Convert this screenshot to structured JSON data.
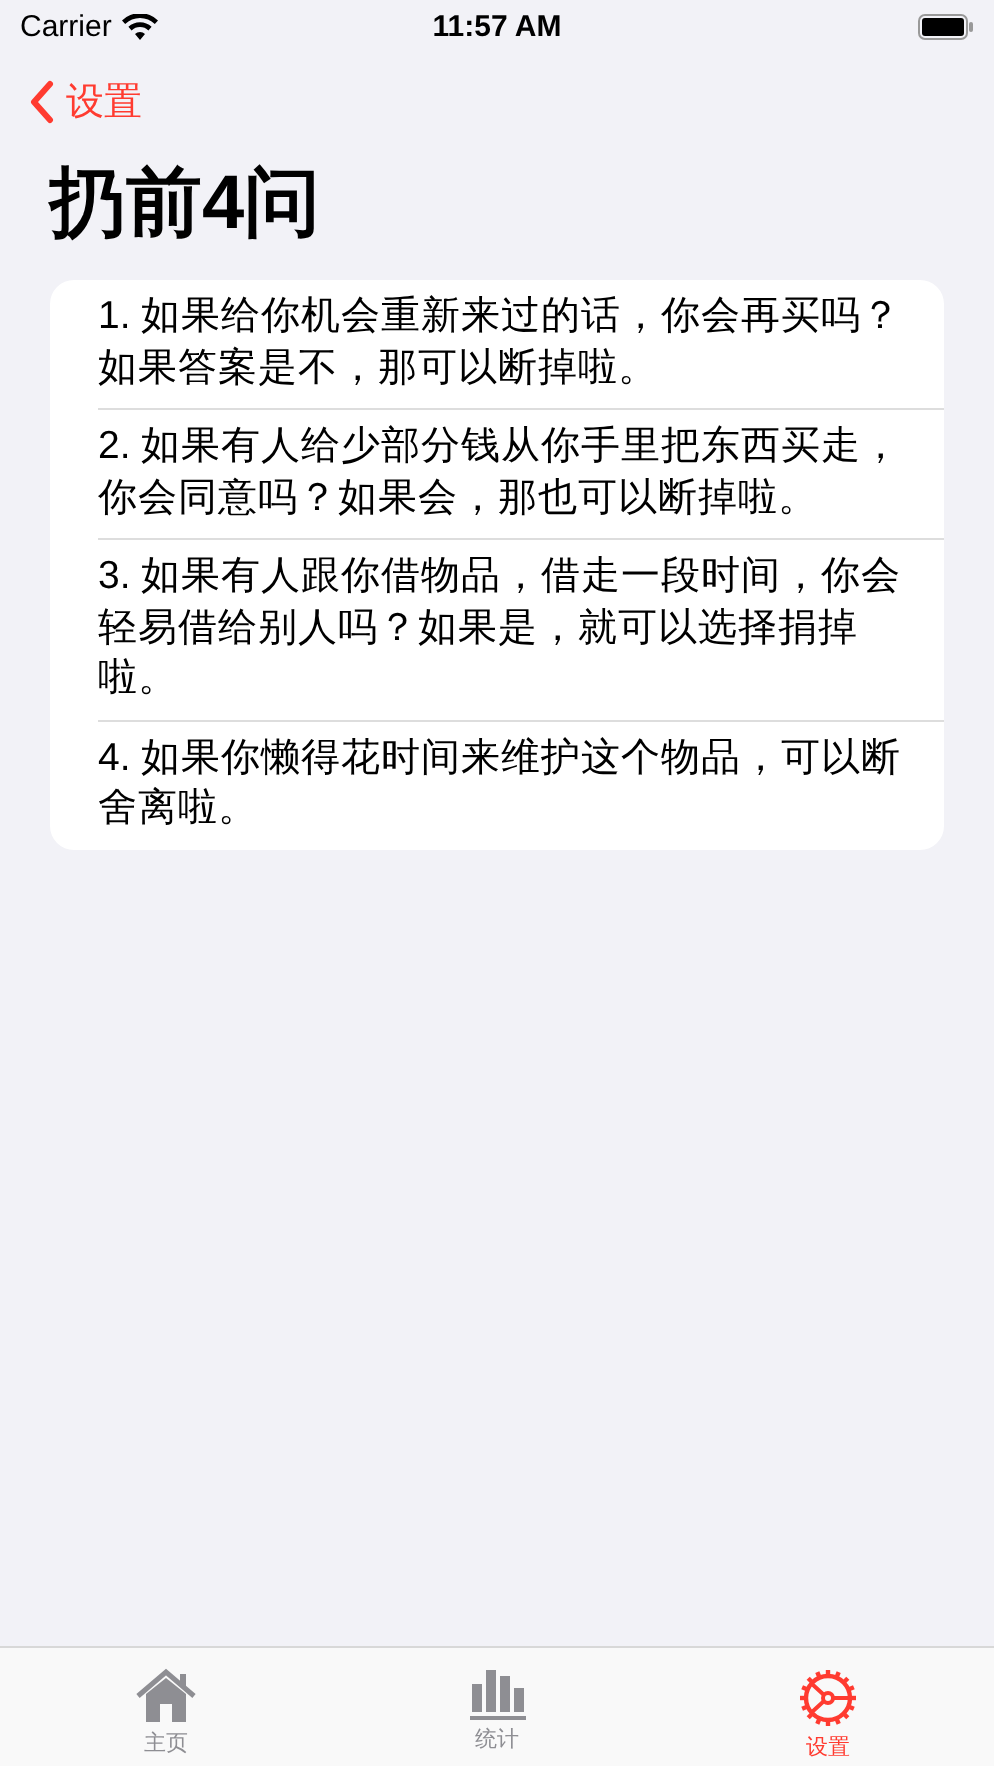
{
  "status_bar": {
    "carrier": "Carrier",
    "time": "11:57 AM"
  },
  "nav": {
    "back_label": "设置"
  },
  "title": "扔前4问",
  "questions": [
    "1. 如果给你机会重新来过的话，你会再买吗？如果答案是不，那可以断掉啦。",
    "2. 如果有人给少部分钱从你手里把东西买走，你会同意吗？如果会，那也可以断掉啦。",
    "3. 如果有人跟你借物品，借走一段时间，你会轻易借给别人吗？如果是，就可以选择捐掉啦。",
    "4. 如果你懒得花时间来维护这个物品，可以断舍离啦。"
  ],
  "tab_bar": [
    {
      "kind": "home",
      "label": "主页",
      "selected": false
    },
    {
      "kind": "stats",
      "label": "统计",
      "selected": false
    },
    {
      "kind": "settings",
      "label": "设置",
      "selected": true
    }
  ]
}
